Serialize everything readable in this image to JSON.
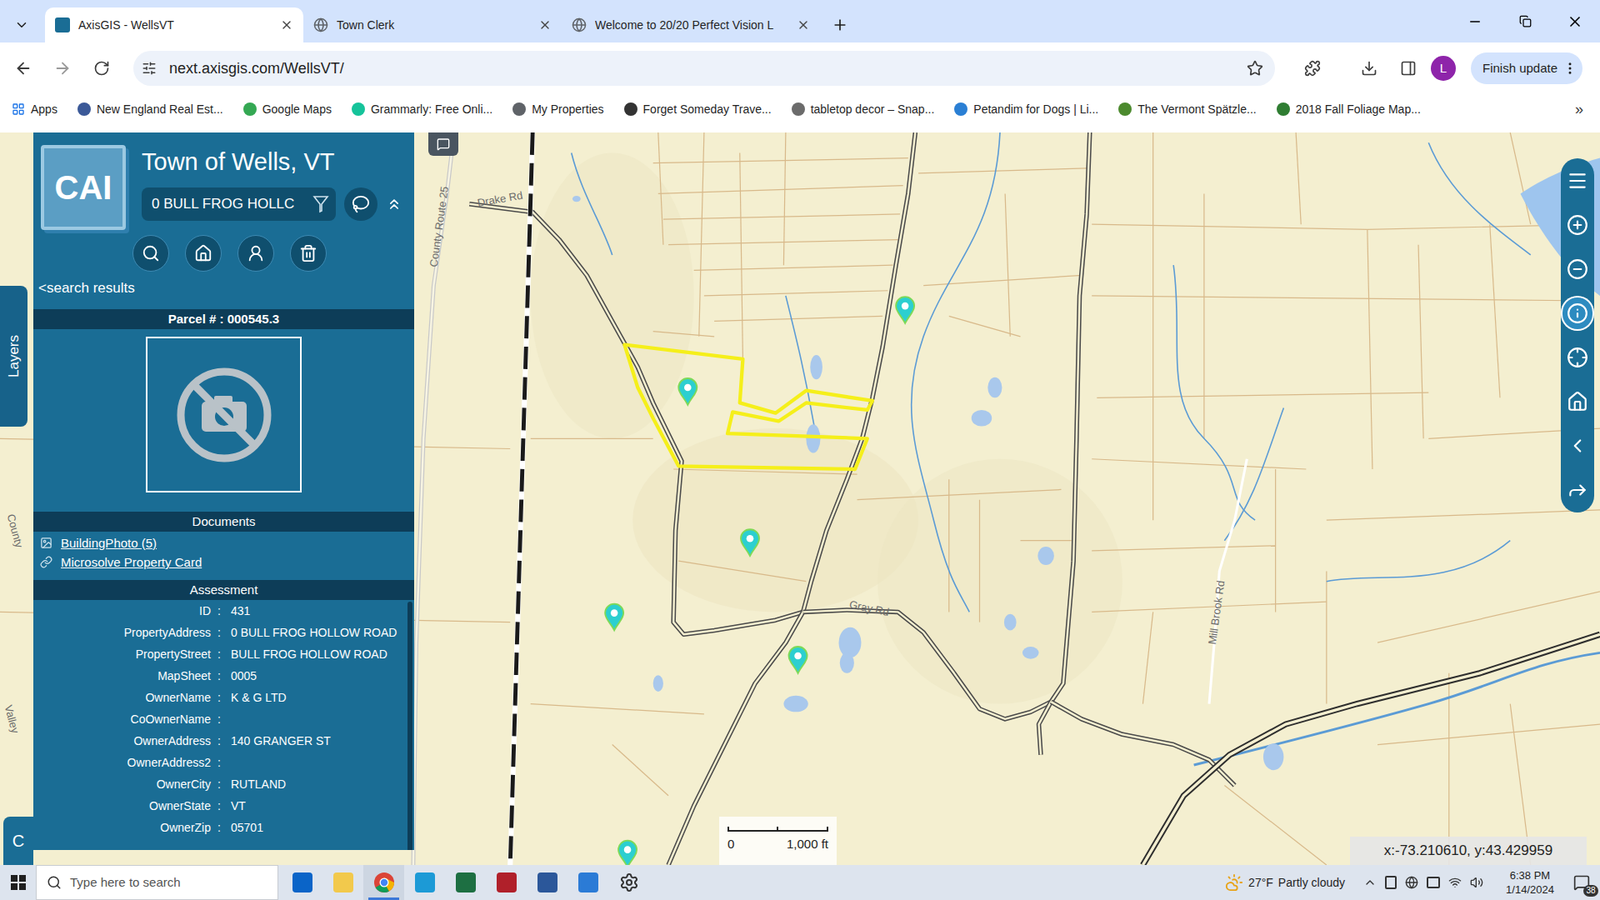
{
  "browser": {
    "tabs": [
      {
        "label": "AxisGIS - WellsVT",
        "selected": true
      },
      {
        "label": "Town Clerk",
        "selected": false
      },
      {
        "label": "Welcome to 20/20 Perfect Vision L",
        "selected": false
      }
    ],
    "url": "next.axisgis.com/WellsVT/",
    "profile_initial": "L",
    "update_button": "Finish update",
    "bookmarks": [
      "Apps",
      "New England Real Est...",
      "Google Maps",
      "Grammarly: Free Onli...",
      "My Properties",
      "Forget Someday Trave...",
      "tabletop decor – Snap...",
      "Petandim for Dogs | Li...",
      "The Vermont Spätzle...",
      "2018 Fall Foliage Map..."
    ],
    "bookmarks_overflow": "»"
  },
  "panel": {
    "logo": "CAI",
    "title": "Town of Wells, VT",
    "search_value": "0 BULL FROG HOLLC",
    "back_link": "<search results",
    "parcel_header": "Parcel # : 000545.3",
    "documents_header": "Documents",
    "documents": [
      "BuildingPhoto (5)",
      "Microsolve Property Card"
    ],
    "assessment_header": "Assessment",
    "separator": ":",
    "assessment": [
      {
        "label": "ID",
        "value": "431"
      },
      {
        "label": "PropertyAddress",
        "value": "0 BULL FROG HOLLOW ROAD"
      },
      {
        "label": "PropertyStreet",
        "value": "BULL FROG HOLLOW ROAD"
      },
      {
        "label": "MapSheet",
        "value": "0005"
      },
      {
        "label": "OwnerName",
        "value": "K & G LTD"
      },
      {
        "label": "CoOwnerName",
        "value": ""
      },
      {
        "label": "OwnerAddress",
        "value": "140 GRANGER ST"
      },
      {
        "label": "OwnerAddress2",
        "value": ""
      },
      {
        "label": "OwnerCity",
        "value": "RUTLAND"
      },
      {
        "label": "OwnerState",
        "value": "VT"
      },
      {
        "label": "OwnerZip",
        "value": "05701"
      }
    ]
  },
  "side_tabs": {
    "layers": "Layers",
    "corner": "C"
  },
  "map": {
    "labels": [
      "Drake Rd",
      "County Route 25",
      "Mill Brook Rd",
      "Gray Rd",
      "County",
      "Valley"
    ],
    "scale_start": "0",
    "scale_end": "1,000 ft",
    "coordinates": "x:-73.210610, y:43.429959",
    "tools": [
      {
        "kind": "menu",
        "selected": false
      },
      {
        "kind": "zoom-in",
        "selected": false
      },
      {
        "kind": "zoom-out",
        "selected": false
      },
      {
        "kind": "identify",
        "selected": true
      },
      {
        "kind": "locate",
        "selected": false
      },
      {
        "kind": "home",
        "selected": false
      },
      {
        "kind": "back",
        "selected": false
      },
      {
        "kind": "share",
        "selected": false
      }
    ]
  },
  "taskbar": {
    "search_placeholder": "Type here to search",
    "apps": [
      {
        "kind": "outlook",
        "active": false
      },
      {
        "kind": "explorer",
        "active": false
      },
      {
        "kind": "chrome",
        "active": true
      },
      {
        "kind": "edge",
        "active": false
      },
      {
        "kind": "excel",
        "active": false
      },
      {
        "kind": "media",
        "active": false
      },
      {
        "kind": "word",
        "active": false
      },
      {
        "kind": "store",
        "active": false
      },
      {
        "kind": "settings",
        "active": false
      }
    ],
    "weather": "27°F",
    "weather_text": "Partly cloudy",
    "time": "6:38 PM",
    "date": "1/14/2024",
    "notification_count": "38"
  }
}
